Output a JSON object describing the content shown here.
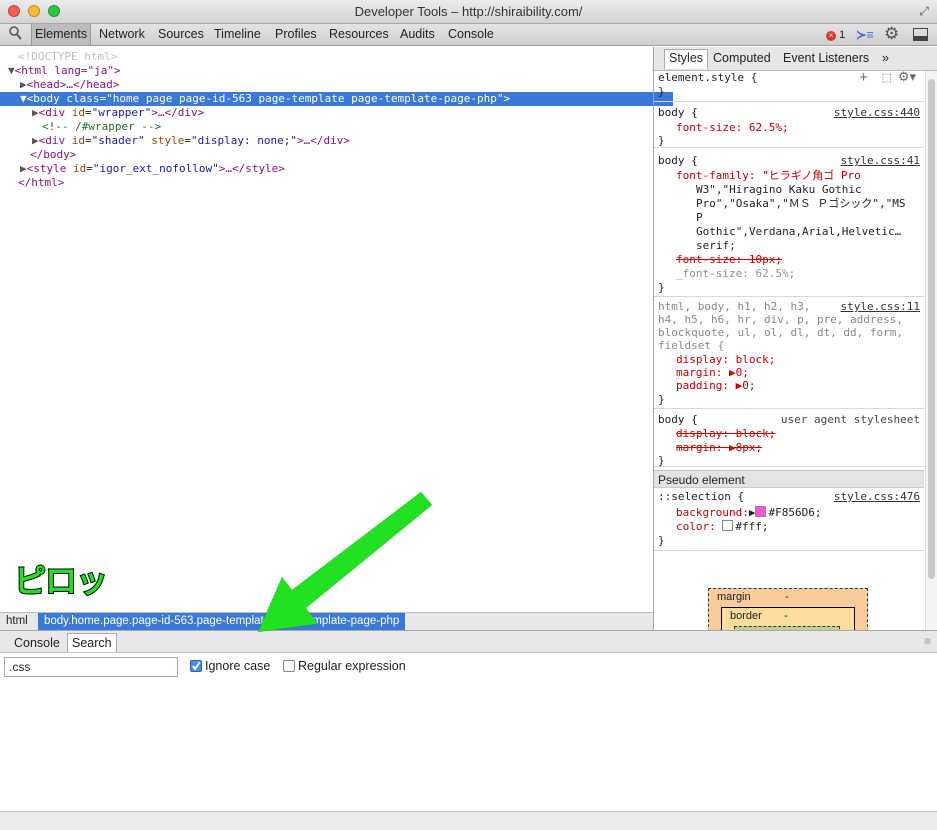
{
  "window": {
    "title": "Developer Tools – http://shiraibility.com/"
  },
  "toolbar": {
    "tabs": [
      "Elements",
      "Network",
      "Sources",
      "Timeline",
      "Profiles",
      "Resources",
      "Audits",
      "Console"
    ],
    "active": "Elements",
    "error_count": "1"
  },
  "dom": {
    "doctype": "<!DOCTYPE html>",
    "html_open": "<html lang=\"ja\">",
    "head": "<head>…</head>",
    "body_tag": "body",
    "body_class_attr": "class",
    "body_class_val": "\"home page page-id-563 page-template page-template-page-php\"",
    "div1_id_val": "\"wrapper\"",
    "comment": "<!-- /#wrapper -->",
    "div2_id_val": "\"shader\"",
    "div2_style_val": "\"display: none;\"",
    "body_close": "</body>",
    "style_id_val": "\"igor_ext_nofollow\"",
    "html_close": "</html>"
  },
  "breadcrumb": {
    "html": "html",
    "body": "body.home.page.page-id-563.page-template.page-template-page-php"
  },
  "sidebar": {
    "tabs": [
      "Styles",
      "Computed",
      "Event Listeners"
    ],
    "more": "»",
    "rules": {
      "element_style": "element.style {",
      "r1_sel": "body {",
      "r1_src": "style.css:440",
      "r1_p1": "font-size: 62.5%;",
      "r2_sel": "body {",
      "r2_src": "style.css:41",
      "r2_l1": "font-family: \"ヒラギノ角ゴ Pro",
      "r2_l2": "W3\",\"Hiragino Kaku Gothic",
      "r2_l3": "Pro\",\"Osaka\",\"ＭＳ Ｐゴシック\",\"MS",
      "r2_l4": "P",
      "r2_l5": "Gothic\",Verdana,Arial,Helvetic…",
      "r2_l6": "serif;",
      "r2_strike": "font-size: 10px;",
      "r2_l7": "_font-size: 62.5%;",
      "r3_sel1": "html, body, h1, h2, h3,",
      "r3_src": "style.css:11",
      "r3_sel2": "h4, h5, h6, hr, div, p, pre, address,",
      "r3_sel3": "blockquote, ul, ol, dl, dt, dd, form,",
      "r3_sel4": "fieldset {",
      "r3_p1": "display: block;",
      "r3_p2": "margin: ▶0;",
      "r3_p3": "padding: ▶0;",
      "r4_sel": "body {",
      "r4_src": "user agent stylesheet",
      "r4_p1": "display: block;",
      "r4_p2": "margin: ▶8px;",
      "pseudo_header": "Pseudo element",
      "r5_sel": "::selection {",
      "r5_src": "style.css:476",
      "r5_bg_name": "background:",
      "r5_bg_val": "#F856D6;",
      "r5_color_name": "color:",
      "r5_color_val": "#fff;",
      "close": "}"
    },
    "boxmodel": {
      "margin": "margin",
      "margin_val": "-",
      "border": "border",
      "border_val": "-"
    }
  },
  "colors": {
    "selection_bg": "#F856D6",
    "accent": "#3879d9",
    "annotation": "#22e022"
  },
  "drawer": {
    "tabs": [
      "Console",
      "Search"
    ],
    "active": "Search",
    "search_value": ".css",
    "ignore_case": "Ignore case",
    "regex": "Regular expression"
  },
  "annotation": {
    "text": "ピロッ"
  }
}
